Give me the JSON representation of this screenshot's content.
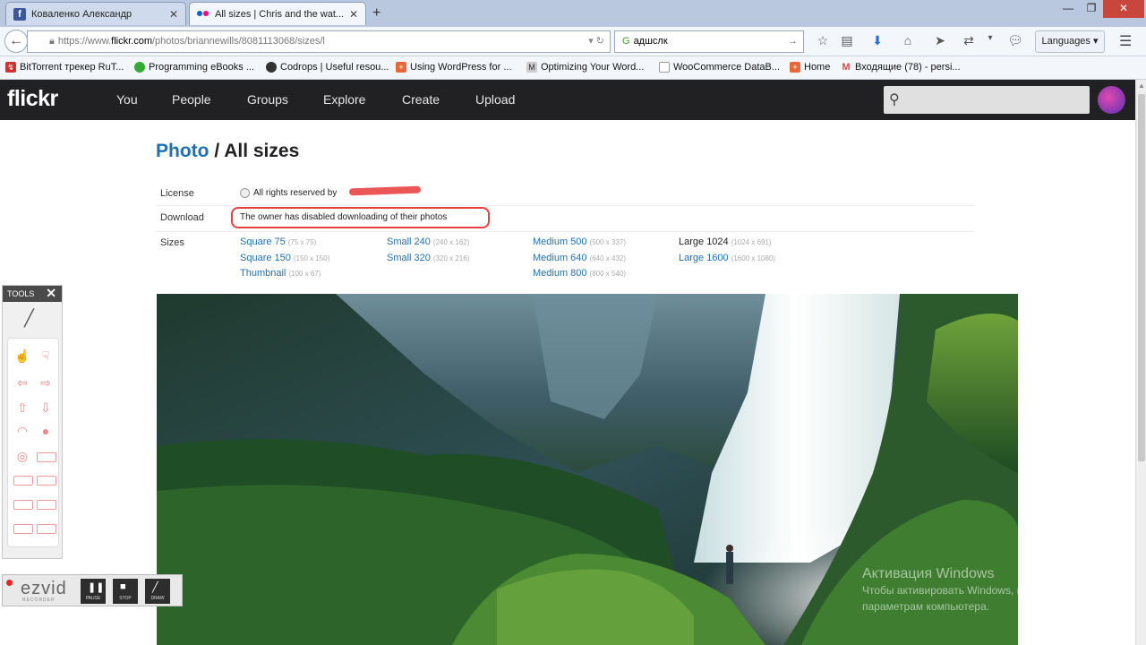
{
  "tabs": [
    {
      "label": "Коваленко Александр",
      "active": false
    },
    {
      "label": "All sizes | Chris and the wat...",
      "active": true
    }
  ],
  "window": {
    "minimize": "—",
    "maximize": "❐",
    "close": "✕"
  },
  "navbar": {
    "url_prefix": "https://www.",
    "url_domain": "flickr.com",
    "url_path": "/photos/briannewills/8081113068/sizes/l",
    "search_value": "адшслк",
    "languages_label": "Languages ▾"
  },
  "bookmarks": [
    {
      "label": "BitTorrent трекер RuT..."
    },
    {
      "label": "Programming eBooks ..."
    },
    {
      "label": "Codrops | Useful resou..."
    },
    {
      "label": "Using WordPress for ..."
    },
    {
      "label": "Optimizing Your Word..."
    },
    {
      "label": "WooCommerce DataB..."
    },
    {
      "label": "Home"
    },
    {
      "label": "Входящие (78) - persi..."
    }
  ],
  "flickr": {
    "logo": "flickr",
    "nav": [
      "You",
      "People",
      "Groups",
      "Explore",
      "Create",
      "Upload"
    ]
  },
  "page": {
    "title_link": "Photo",
    "title_rest": " / All sizes",
    "license_label": "License",
    "license_value": "All rights reserved by",
    "download_label": "Download",
    "download_value": "The owner has disabled downloading of their photos",
    "sizes_label": "Sizes",
    "sizes": [
      {
        "name": "Square 75",
        "dims": "(75 x 75)"
      },
      {
        "name": "Square 150",
        "dims": "(150 x 150)"
      },
      {
        "name": "Thumbnail",
        "dims": "(100 x 67)"
      },
      {
        "name": "Small 240",
        "dims": "(240 x 162)"
      },
      {
        "name": "Small 320",
        "dims": "(320 x 216)"
      },
      {
        "name": "Medium 500",
        "dims": "(500 x 337)"
      },
      {
        "name": "Medium 640",
        "dims": "(640 x 432)"
      },
      {
        "name": "Medium 800",
        "dims": "(800 x 540)"
      },
      {
        "name": "Large 1024",
        "dims": "(1024 x 691)"
      },
      {
        "name": "Large 1600",
        "dims": "(1600 x 1080)"
      }
    ]
  },
  "watermark": {
    "line1": "Активация Windows",
    "line2": "Чтобы активировать Windows, перейдите к",
    "line3": "параметрам компьютера."
  },
  "tools_panel": {
    "title": "TOOLS",
    "close": "✕"
  },
  "ezvid": {
    "logo": "ezvid",
    "subtitle": "RECORDER",
    "buttons": [
      "PAUSE",
      "STOP",
      "DRAW"
    ]
  }
}
